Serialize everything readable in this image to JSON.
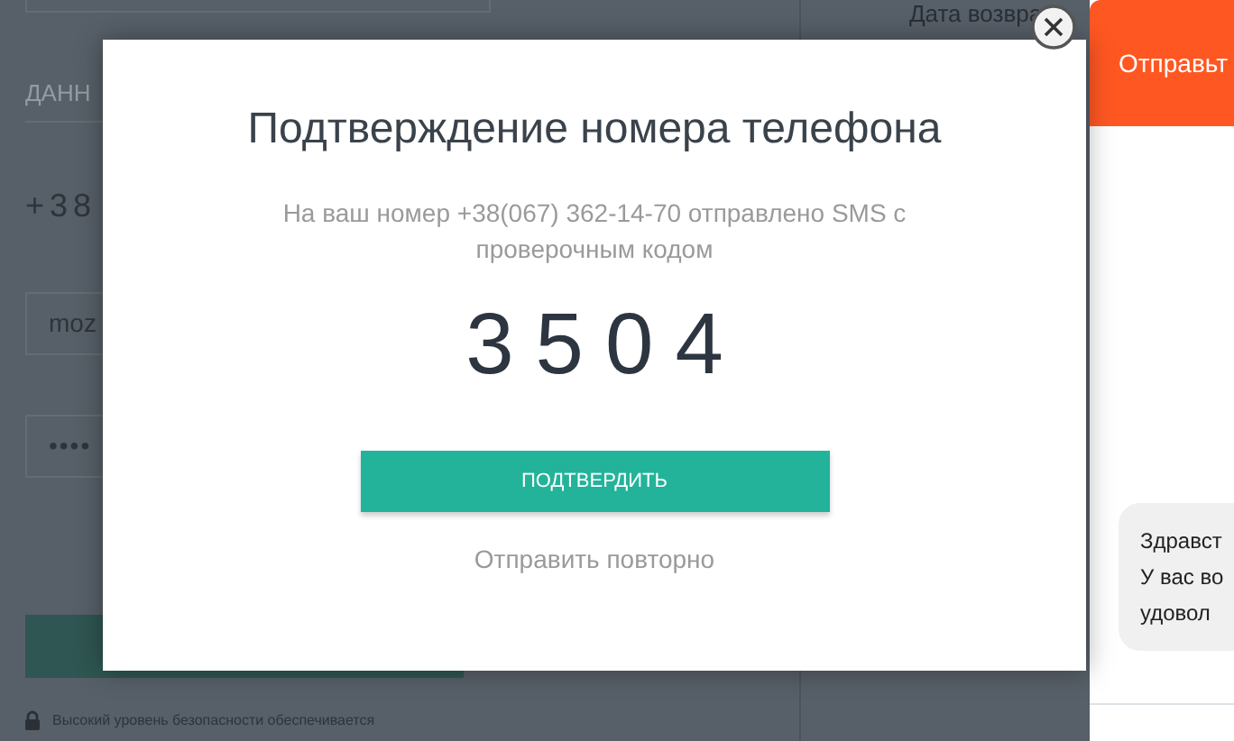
{
  "background": {
    "column_header": "Дата возвра",
    "form": {
      "section_label": "ДАНН",
      "phone": "+38",
      "email_value": "moz",
      "password_value": "••••",
      "security_note": "Высокий уровень безопасности обеспечивается"
    }
  },
  "dialog": {
    "title": "Подтверждение номера телефона",
    "message": "На ваш номер +38(067) 362-14-70 отправлено SMS с проверочным кодом",
    "code": "3504",
    "confirm_button": "ПОДТВЕРДИТЬ",
    "resend_link": "Отправить повторно"
  },
  "chat": {
    "header": "Отправьт",
    "message_lines": [
      "Здравст",
      "У вас во",
      "удовол"
    ]
  }
}
